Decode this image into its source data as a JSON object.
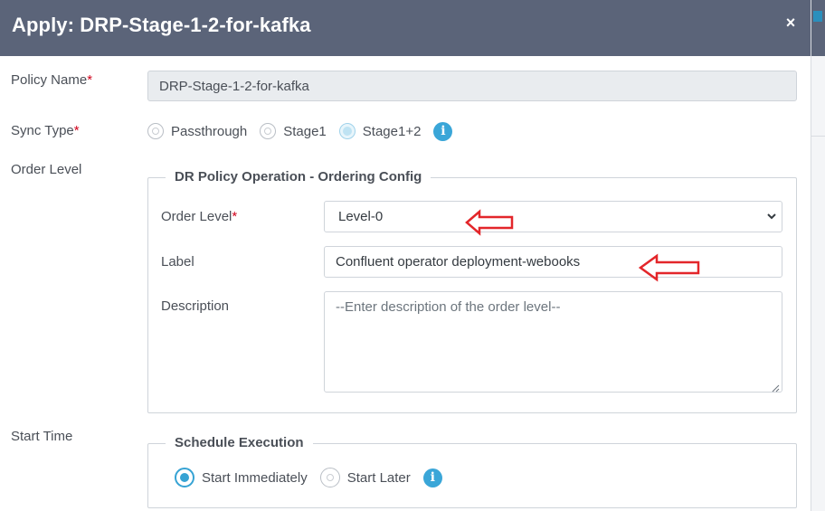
{
  "header": {
    "title": "Apply: DRP-Stage-1-2-for-kafka",
    "close": "×"
  },
  "policy_name": {
    "label": "Policy Name",
    "required": "*",
    "value": "DRP-Stage-1-2-for-kafka"
  },
  "sync_type": {
    "label": "Sync Type",
    "required": "*",
    "options": [
      "Passthrough",
      "Stage1",
      "Stage1+2"
    ],
    "selected": "Stage1+2",
    "info_glyph": "i"
  },
  "order_level_section": {
    "label": "Order Level",
    "legend": "DR Policy Operation - Ordering Config",
    "order_level": {
      "label": "Order Level",
      "required": "*",
      "selected": "Level-0"
    },
    "label_field": {
      "label": "Label",
      "value": "Confluent operator deployment-webooks"
    },
    "description": {
      "label": "Description",
      "placeholder": "--Enter description of the order level--"
    }
  },
  "start_time": {
    "label": "Start Time",
    "legend": "Schedule Execution",
    "options": [
      "Start Immediately",
      "Start Later"
    ],
    "selected": "Start Immediately",
    "info_glyph": "i"
  },
  "colors": {
    "header_bg": "#5b6479",
    "accent": "#36a3d4",
    "required": "#d0021b",
    "annotation_arrow": "#e3262a"
  }
}
